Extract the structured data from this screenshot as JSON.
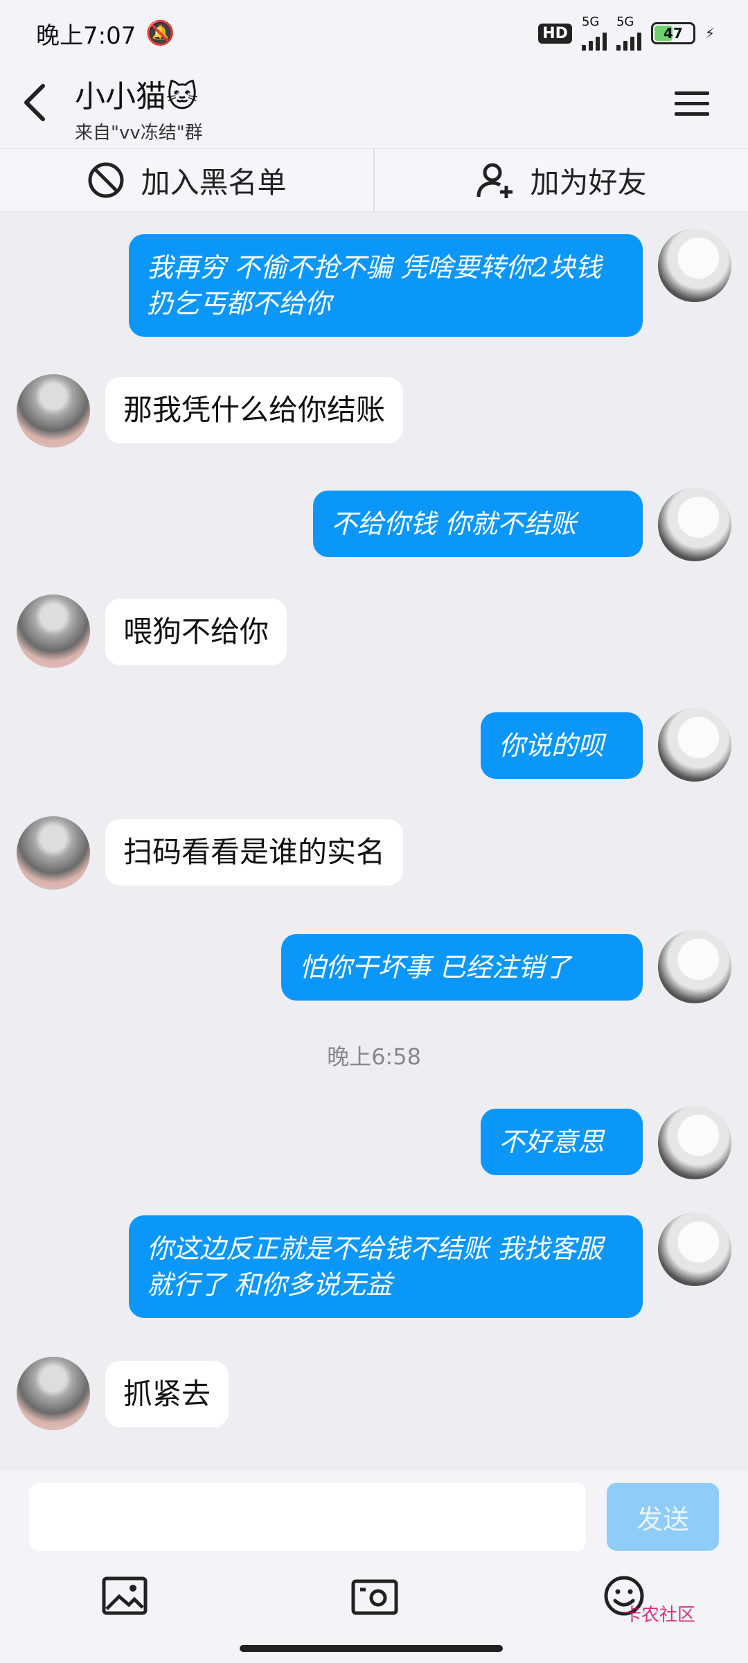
{
  "status_bar": {
    "time": "晚上7:07",
    "hd_label": "HD",
    "net1": "5G",
    "net2": "5G",
    "battery": "47"
  },
  "header": {
    "title": "小小猫🐱",
    "subtitle": "来自\"vv冻结\"群"
  },
  "actions": {
    "block_label": "加入黑名单",
    "add_friend_label": "加为好友"
  },
  "messages": [
    {
      "dir": "out",
      "text": "我再穷 不偷不抢不骗 凭啥要转你2块钱 扔乞丐都不给你"
    },
    {
      "dir": "in",
      "text": "那我凭什么给你结账"
    },
    {
      "dir": "out",
      "text": "不给你钱 你就不结账"
    },
    {
      "dir": "in",
      "text": "喂狗不给你"
    },
    {
      "dir": "out",
      "text": "你说的呗"
    },
    {
      "dir": "in",
      "text": "扫码看看是谁的实名"
    },
    {
      "dir": "out",
      "text": "怕你干坏事 已经注销了"
    },
    {
      "dir": "out",
      "text": "不好意思"
    },
    {
      "dir": "out",
      "text": "你这边反正就是不给钱不结账 我找客服就行了 和你多说无益"
    },
    {
      "dir": "in",
      "text": "抓紧去"
    }
  ],
  "timestamp": "晚上6:58",
  "composer": {
    "send_label": "发送"
  },
  "toolbar": {
    "icons": [
      "image-icon",
      "camera-icon",
      "emoji-icon"
    ]
  },
  "watermark": "卡农社区"
}
